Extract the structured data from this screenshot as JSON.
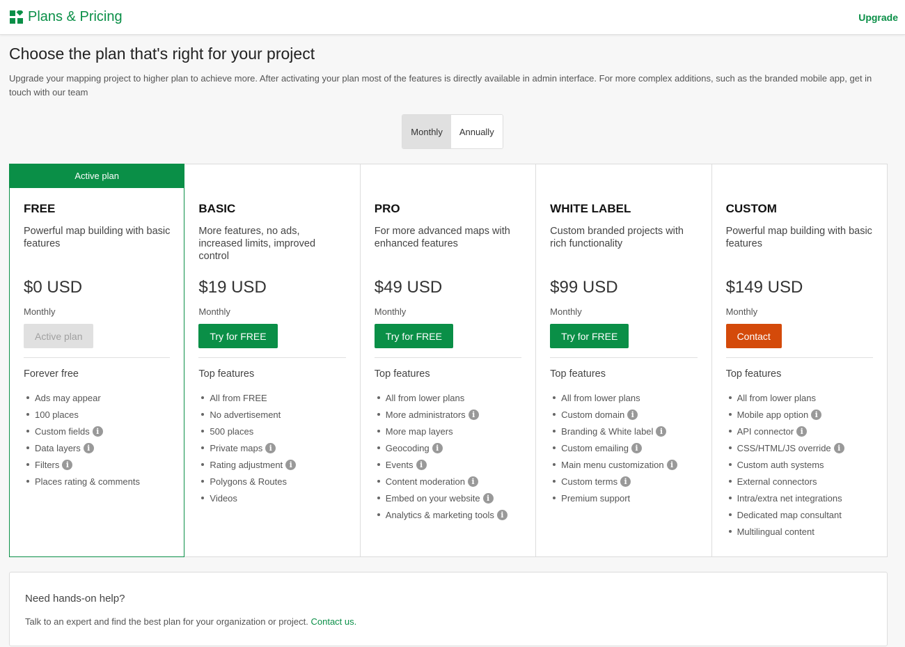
{
  "header": {
    "title": "Plans & Pricing",
    "upgrade_label": "Upgrade",
    "logo_icon": "grid-logo-icon",
    "brand_color": "#0a8f47"
  },
  "page": {
    "title": "Choose the plan that's right for your project",
    "description": "Upgrade your mapping project to higher plan to achieve more. After activating your plan most of the features is directly available in admin interface. For more complex additions, such as the branded mobile app, get in touch with our team"
  },
  "billing_toggle": {
    "monthly": "Monthly",
    "annually": "Annually",
    "selected": "Monthly"
  },
  "plans": [
    {
      "ribbon": "Active plan",
      "name": "FREE",
      "desc": "Powerful map building with basic features",
      "price": "$0 USD",
      "period": "Monthly",
      "button": "Active plan",
      "features_title": "Forever free",
      "features": [
        {
          "text": "Ads may appear",
          "info": false
        },
        {
          "text": "100 places",
          "info": false
        },
        {
          "text": "Custom fields",
          "info": true
        },
        {
          "text": "Data layers",
          "info": true
        },
        {
          "text": "Filters",
          "info": true
        },
        {
          "text": "Places rating & comments",
          "info": false
        }
      ]
    },
    {
      "name": "BASIC",
      "desc": "More features, no ads, increased limits, improved control",
      "price": "$19 USD",
      "period": "Monthly",
      "button": "Try for FREE",
      "features_title": "Top features",
      "features": [
        {
          "text": "All from FREE",
          "info": false
        },
        {
          "text": "No advertisement",
          "info": false
        },
        {
          "text": "500 places",
          "info": false
        },
        {
          "text": "Private maps",
          "info": true
        },
        {
          "text": "Rating adjustment",
          "info": true
        },
        {
          "text": "Polygons & Routes",
          "info": false
        },
        {
          "text": "Videos",
          "info": false
        }
      ]
    },
    {
      "name": "PRO",
      "desc": "For more advanced maps with enhanced features",
      "price": "$49 USD",
      "period": "Monthly",
      "button": "Try for FREE",
      "features_title": "Top features",
      "features": [
        {
          "text": "All from lower plans",
          "info": false
        },
        {
          "text": "More administrators",
          "info": true
        },
        {
          "text": "More map layers",
          "info": false
        },
        {
          "text": "Geocoding",
          "info": true
        },
        {
          "text": "Events",
          "info": true
        },
        {
          "text": "Content moderation",
          "info": true
        },
        {
          "text": "Embed on your website",
          "info": true
        },
        {
          "text": "Analytics & marketing tools",
          "info": true
        }
      ]
    },
    {
      "name": "WHITE LABEL",
      "desc": "Custom branded projects with rich functionality",
      "price": "$99 USD",
      "period": "Monthly",
      "button": "Try for FREE",
      "features_title": "Top features",
      "features": [
        {
          "text": "All from lower plans",
          "info": false
        },
        {
          "text": "Custom domain",
          "info": true
        },
        {
          "text": "Branding & White label",
          "info": true
        },
        {
          "text": "Custom emailing",
          "info": true
        },
        {
          "text": "Main menu customization",
          "info": true
        },
        {
          "text": "Custom terms",
          "info": true
        },
        {
          "text": "Premium support",
          "info": false
        }
      ]
    },
    {
      "name": "CUSTOM",
      "desc": "Powerful map building with basic features",
      "price": "$149 USD",
      "period": "Monthly",
      "button": "Contact",
      "features_title": "Top features",
      "features": [
        {
          "text": "All from lower plans",
          "info": false
        },
        {
          "text": "Mobile app option",
          "info": true
        },
        {
          "text": "API connector",
          "info": true
        },
        {
          "text": "CSS/HTML/JS override",
          "info": true
        },
        {
          "text": "Custom auth systems",
          "info": false
        },
        {
          "text": "External connectors",
          "info": false
        },
        {
          "text": "Intra/extra net integrations",
          "info": false
        },
        {
          "text": "Dedicated map consultant",
          "info": false
        },
        {
          "text": "Multilingual content",
          "info": false
        }
      ]
    }
  ],
  "help": {
    "title": "Need hands-on help?",
    "text": "Talk to an expert and find the best plan for your organization or project.",
    "link": "Contact us."
  },
  "colors": {
    "accent": "#0a8f47",
    "contact": "#d44a0a",
    "disabled": "#e0e0e0"
  }
}
